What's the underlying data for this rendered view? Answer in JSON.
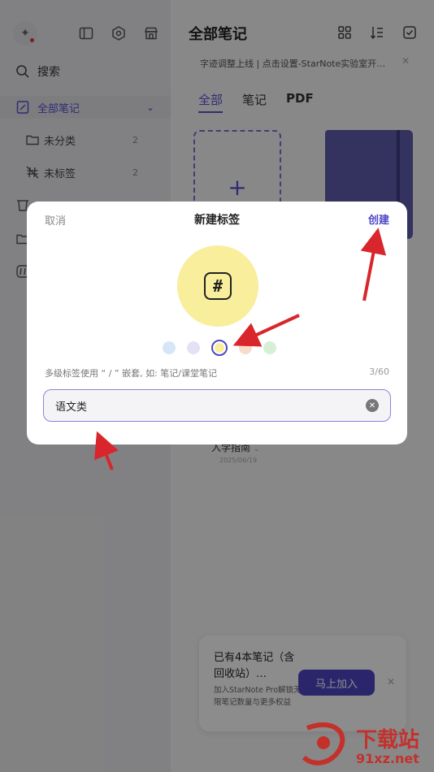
{
  "sidebar": {
    "search_label": "搜索",
    "items": [
      {
        "label": "全部笔记",
        "count": ""
      },
      {
        "label": "未分类",
        "count": "2"
      },
      {
        "label": "未标签",
        "count": "2"
      }
    ]
  },
  "main": {
    "title": "全部笔记",
    "banner": "字迹调整上线 | 点击设置-StarNote实验室开…",
    "tabs": [
      {
        "label": "全部"
      },
      {
        "label": "笔记"
      },
      {
        "label": "PDF"
      }
    ],
    "note": {
      "title": "入学指南",
      "date": "2025/06/19"
    }
  },
  "promo": {
    "title": "已有4本笔记（含回收站）…",
    "description": "加入StarNote Pro解锁无限笔记数量与更多权益",
    "button_label": "马上加入"
  },
  "dialog": {
    "cancel_label": "取消",
    "title": "新建标签",
    "create_label": "创建",
    "tag_symbol": "#",
    "swatches": [
      {
        "color": "#d6e6f7",
        "selected": false
      },
      {
        "color": "#e6e0f7",
        "selected": false
      },
      {
        "color": "#f8ee9c",
        "selected": true
      },
      {
        "color": "#f7dccb",
        "selected": false
      },
      {
        "color": "#d6f0d6",
        "selected": false
      }
    ],
    "hint": "多级标签使用 “ / ” 嵌套, 如: 笔记/课堂笔记",
    "char_count": "3/60",
    "input_value": "语文类"
  },
  "watermark": {
    "text": "下载站",
    "url": "91xz.net"
  },
  "colors": {
    "accent": "#4f46c5",
    "annotation": "#d8262c"
  }
}
